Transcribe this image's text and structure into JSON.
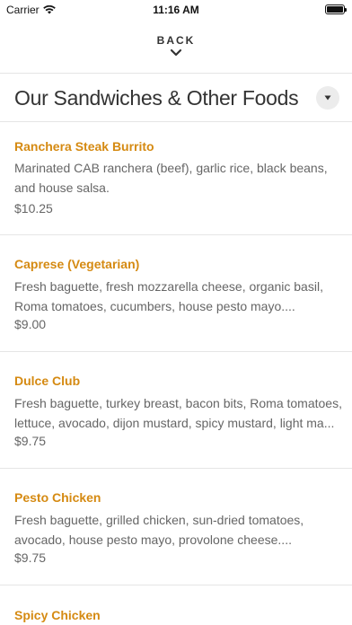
{
  "status": {
    "carrier": "Carrier",
    "time": "11:16 AM"
  },
  "nav": {
    "back_label": "BACK"
  },
  "section": {
    "title": "Our Sandwiches & Other Foods"
  },
  "items": [
    {
      "name": "Ranchera Steak Burrito",
      "desc_line1": "Marinated CAB ranchera (beef), garlic rice, black beans,",
      "desc_line2": "and house salsa.",
      "price": "$10.25"
    },
    {
      "name": "Caprese (Vegetarian)",
      "desc_line1": "Fresh baguette, fresh mozzarella cheese, organic basil,",
      "desc_line2": "Roma tomatoes, cucumbers, house pesto mayo....",
      "price": "$9.00"
    },
    {
      "name": "Dulce Club",
      "desc_line1": "Fresh baguette, turkey breast, bacon bits, Roma tomatoes,",
      "desc_line2": "lettuce, avocado, dijon mustard, spicy mustard, light ma...",
      "price": "$9.75"
    },
    {
      "name": "Pesto Chicken",
      "desc_line1": "Fresh baguette, grilled chicken, sun-dried tomatoes,",
      "desc_line2": "avocado, house pesto mayo, provolone cheese....",
      "price": "$9.75"
    },
    {
      "name": "Spicy Chicken"
    }
  ]
}
